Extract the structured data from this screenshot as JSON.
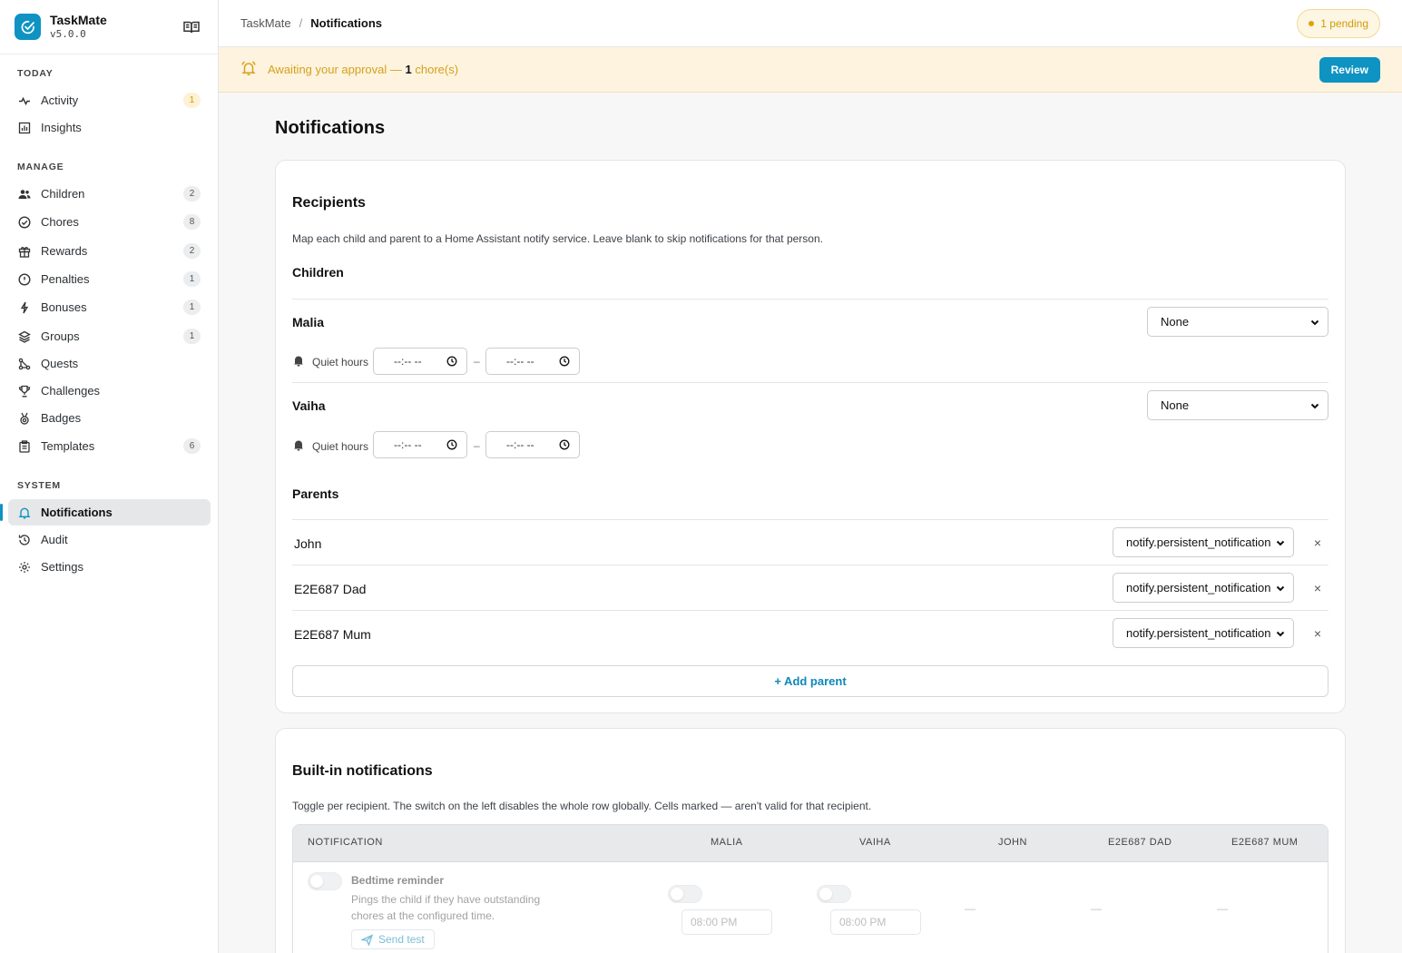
{
  "app": {
    "name": "TaskMate",
    "version": "v5.0.0"
  },
  "sidebar": {
    "sections": [
      {
        "title": "TODAY",
        "items": [
          {
            "label": "Activity",
            "count": "1",
            "icon": "activity-icon"
          },
          {
            "label": "Insights",
            "count": "",
            "icon": "insights-icon"
          }
        ]
      },
      {
        "title": "MANAGE",
        "items": [
          {
            "label": "Children",
            "count": "2",
            "icon": "users-icon"
          },
          {
            "label": "Chores",
            "count": "8",
            "icon": "check-circle-icon"
          },
          {
            "label": "Rewards",
            "count": "2",
            "icon": "gift-icon"
          },
          {
            "label": "Penalties",
            "count": "1",
            "icon": "alert-circle-icon"
          },
          {
            "label": "Bonuses",
            "count": "1",
            "icon": "bolt-icon"
          },
          {
            "label": "Groups",
            "count": "1",
            "icon": "layers-icon"
          },
          {
            "label": "Quests",
            "count": "",
            "icon": "route-icon"
          },
          {
            "label": "Challenges",
            "count": "",
            "icon": "trophy-icon"
          },
          {
            "label": "Badges",
            "count": "",
            "icon": "medal-icon"
          },
          {
            "label": "Templates",
            "count": "6",
            "icon": "clipboard-icon"
          }
        ]
      },
      {
        "title": "SYSTEM",
        "items": [
          {
            "label": "Notifications",
            "count": "",
            "icon": "bell-icon",
            "active": true
          },
          {
            "label": "Audit",
            "count": "",
            "icon": "history-icon"
          },
          {
            "label": "Settings",
            "count": "",
            "icon": "gear-icon"
          }
        ]
      }
    ]
  },
  "topbar": {
    "breadcrumb_root": "TaskMate",
    "breadcrumb_sep": "/",
    "breadcrumb_current": "Notifications",
    "pending_label": "1 pending"
  },
  "banner": {
    "text_before": "Awaiting your approval — ",
    "count": "1",
    "text_after": " chore(s)",
    "review_label": "Review"
  },
  "page": {
    "title": "Notifications"
  },
  "recipients": {
    "title": "Recipients",
    "description": "Map each child and parent to a Home Assistant notify service. Leave blank to skip notifications for that person.",
    "children_heading": "Children",
    "children": [
      {
        "name": "Malia",
        "service": "None",
        "quiet_label": "Quiet hours",
        "start": "--:-- --",
        "end": "--:-- --"
      },
      {
        "name": "Vaiha",
        "service": "None",
        "quiet_label": "Quiet hours",
        "start": "--:-- --",
        "end": "--:-- --"
      }
    ],
    "dash": "–",
    "parents_heading": "Parents",
    "parents": [
      {
        "name": "John",
        "service": "notify.persistent_notification"
      },
      {
        "name": "E2E687 Dad",
        "service": "notify.persistent_notification"
      },
      {
        "name": "E2E687 Mum",
        "service": "notify.persistent_notification"
      }
    ],
    "remove_symbol": "×",
    "add_parent_label": "+ Add parent"
  },
  "builtin": {
    "title": "Built-in notifications",
    "description": "Toggle per recipient. The switch on the left disables the whole row globally. Cells marked — aren't valid for that recipient.",
    "columns": [
      "NOTIFICATION",
      "MALIA",
      "VAIHA",
      "JOHN",
      "E2E687 DAD",
      "E2E687 MUM"
    ],
    "rows": [
      {
        "title": "Bedtime reminder",
        "description": "Pings the child if they have outstanding chores at the configured time.",
        "send_test_label": "Send test",
        "malia_time": "08:00 PM",
        "vaiha_time": "08:00 PM",
        "not_applicable": "—"
      }
    ]
  },
  "colors": {
    "accent": "#0e93c2",
    "warning": "#d39a06",
    "banner_bg": "#fdf3df"
  }
}
